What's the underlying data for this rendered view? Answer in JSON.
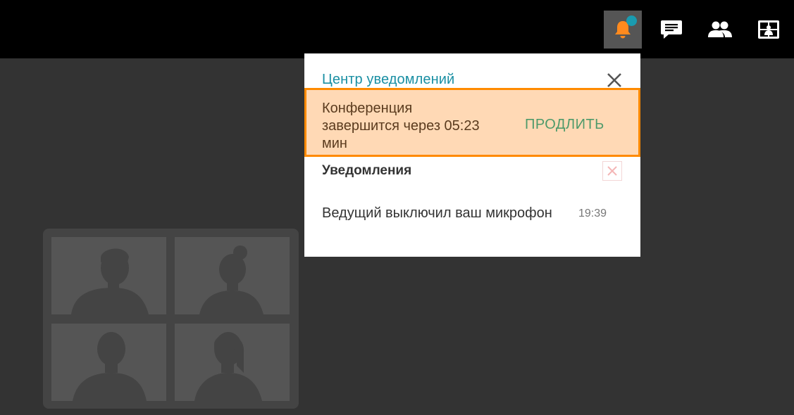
{
  "toolbar": {
    "buttons": [
      {
        "icon": "bell-icon",
        "active": true,
        "badge": true
      },
      {
        "icon": "chat-icon"
      },
      {
        "icon": "participants-icon"
      },
      {
        "icon": "layout-icon"
      }
    ]
  },
  "notification_center": {
    "title": "Центр уведомлений",
    "alert": {
      "line1": "Конференция",
      "line2": "завершится через 05:23",
      "line3": "мин",
      "action_label": "ПРОДЛИТЬ"
    },
    "section_title": "Уведомления",
    "items": [
      {
        "text": "Ведущий выключил ваш микрофон",
        "time": "19:39"
      }
    ]
  },
  "colors": {
    "accent": "#1a8fa3",
    "alert_bg": "#ffd9b5",
    "alert_border": "#ff8a00",
    "action": "#4e9a6a",
    "bell": "#ff8a1e"
  }
}
